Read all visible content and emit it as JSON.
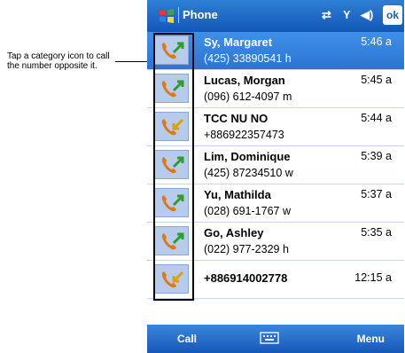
{
  "callout": {
    "text": "Tap a category icon to call the number opposite it."
  },
  "titlebar": {
    "title": "Phone",
    "ok_label": "ok"
  },
  "calls": [
    {
      "name": "Sy, Margaret",
      "phone": "(425) 33890541 h",
      "time": "5:46 a",
      "direction": "outgoing",
      "selected": true
    },
    {
      "name": "Lucas, Morgan",
      "phone": "(096) 612-4097 m",
      "time": "5:45 a",
      "direction": "outgoing"
    },
    {
      "name": "TCC NU NO",
      "phone": "+886922357473",
      "time": "5:44 a",
      "direction": "incoming"
    },
    {
      "name": "Lim, Dominique",
      "phone": "(425) 87234510 w",
      "time": "5:39 a",
      "direction": "outgoing"
    },
    {
      "name": "Yu, Mathilda",
      "phone": "(028) 691-1767 w",
      "time": "5:37 a",
      "direction": "outgoing"
    },
    {
      "name": "Go, Ashley",
      "phone": "(022) 977-2329 h",
      "time": "5:35 a",
      "direction": "outgoing"
    },
    {
      "name": "+886914002778",
      "phone": "",
      "time": "12:15 a",
      "direction": "incoming"
    }
  ],
  "menubar": {
    "left_label": "Call",
    "right_label": "Menu"
  },
  "colors": {
    "accent": "#1a66c8",
    "outgoing_arrow": "#2e9d2e",
    "incoming_arrow": "#e0a000",
    "handset": "#e07a10"
  }
}
